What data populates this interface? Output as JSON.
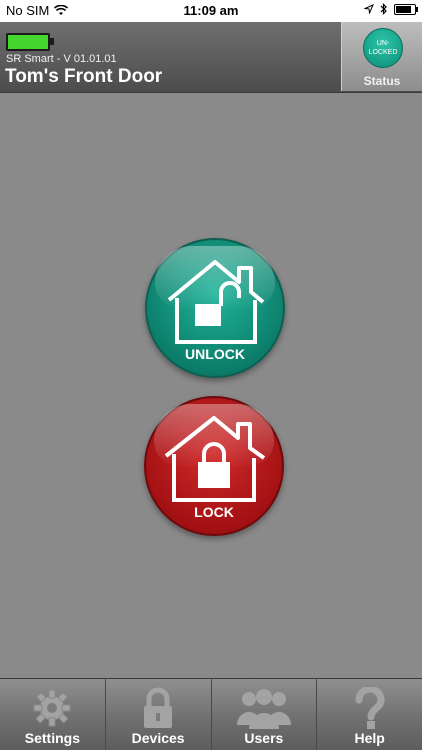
{
  "status_bar": {
    "carrier": "No SIM",
    "time": "11:09 am"
  },
  "header": {
    "version": "SR Smart - V 01.01.01",
    "door_name": "Tom's Front Door",
    "status_badge": "UN-\nLOCKED",
    "status_label": "Status"
  },
  "controls": {
    "unlock_label": "UNLOCK",
    "lock_label": "LOCK"
  },
  "tabbar": {
    "settings": "Settings",
    "devices": "Devices",
    "users": "Users",
    "help": "Help"
  },
  "colors": {
    "unlock_green": "#0f8f78",
    "lock_red": "#a50f12",
    "battery_green": "#45d62e"
  },
  "icons": {
    "unlock": "house-open-padlock-icon",
    "lock": "house-closed-padlock-icon",
    "settings": "gear-icon",
    "devices": "padlock-icon",
    "users": "users-group-icon",
    "help": "question-mark-icon"
  }
}
